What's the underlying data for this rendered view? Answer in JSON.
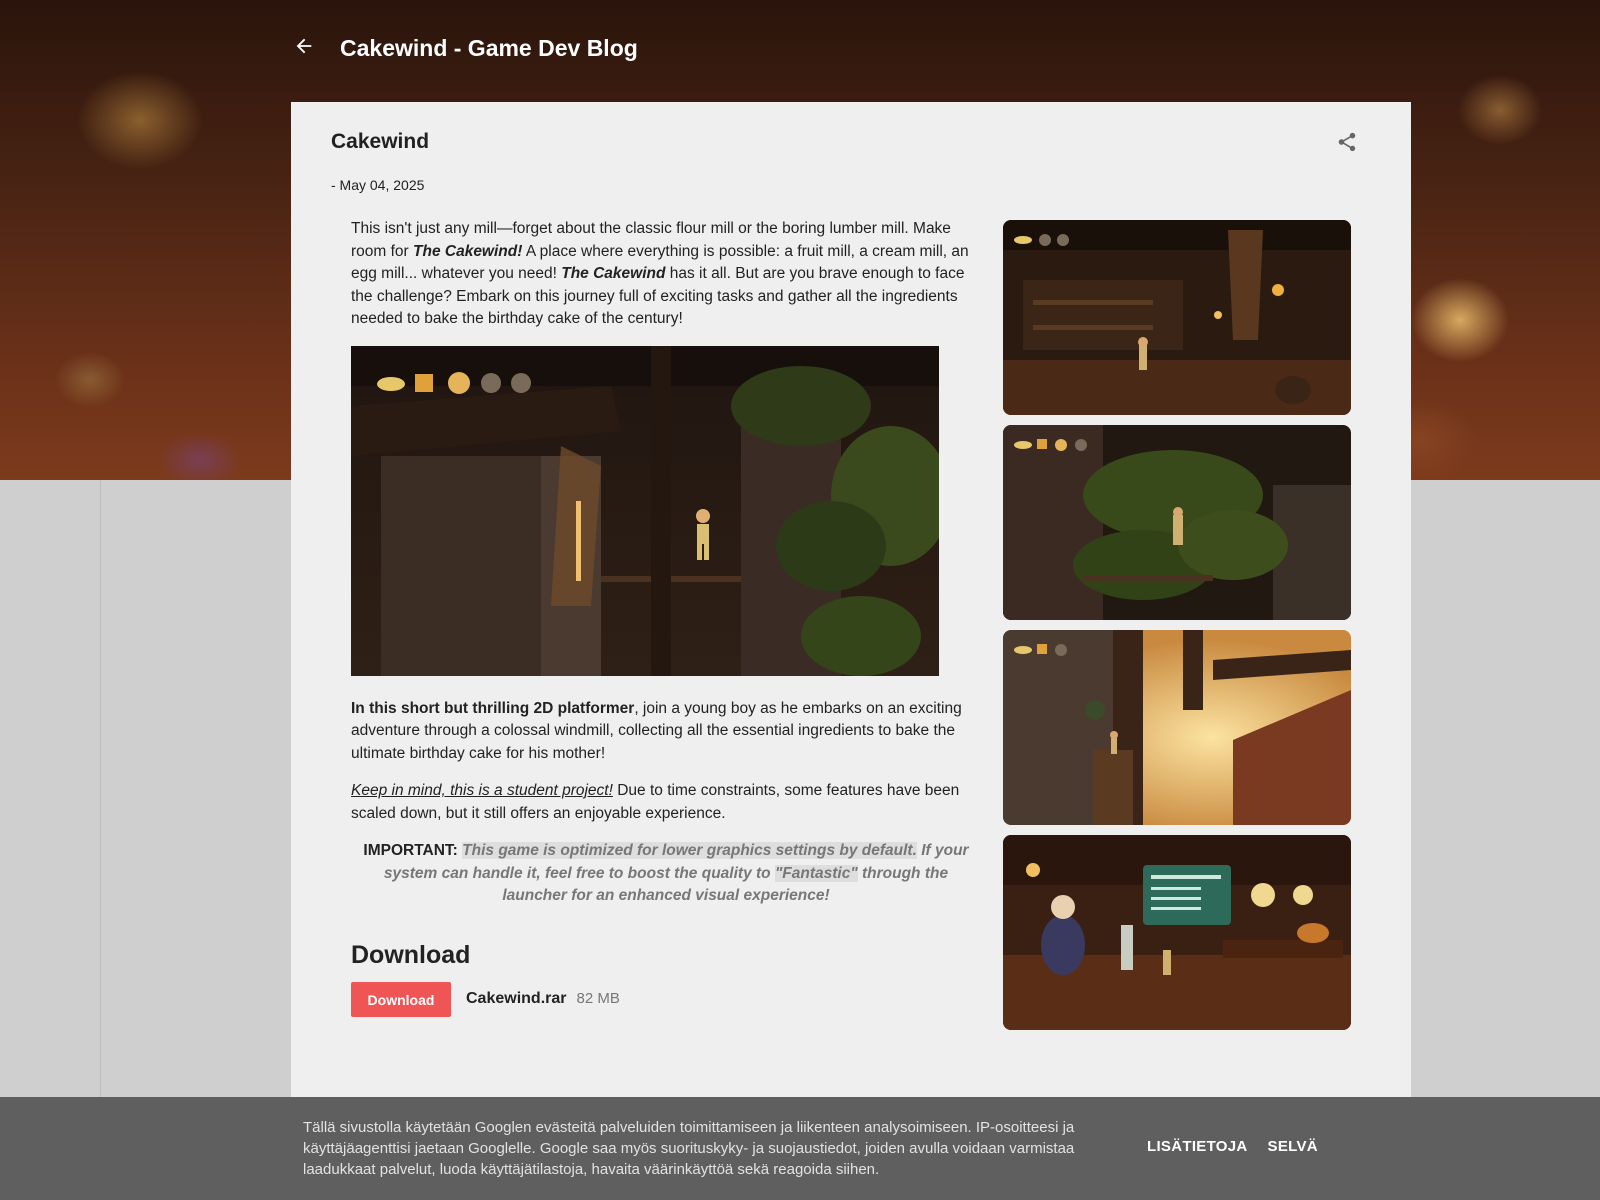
{
  "header": {
    "blog_title": "Cakewind - Game Dev Blog",
    "back_icon": "arrow-left-icon"
  },
  "post": {
    "title": "Cakewind",
    "date": "- May 04, 2025",
    "share_icon": "share-icon",
    "intro": {
      "t1": "This isn't just any mill—forget about the classic flour mill or the boring lumber mill. Make room for ",
      "b1": "The Cakewind!",
      "t2": " A place where everything is possible: a fruit mill, a cream mill, an egg mill... whatever you need! ",
      "b2": "The Cakewind",
      "t3": " has it all. But are you brave enough to face the challenge? Embark on this journey full of exciting tasks and gather all the ingredients needed to bake the birthday cake of the century!"
    },
    "platformer": {
      "bold": "In this short but thrilling 2D platformer",
      "rest": ", join a young boy as he embarks on an exciting adventure through a colossal windmill, collecting all the essential ingredients to bake the ultimate birthday cake for his mother!"
    },
    "student": {
      "link": "Keep in mind, this is a student project!",
      "rest": " Due to time constraints, some features have been scaled down, but it still offers an enjoyable experience."
    },
    "important": {
      "label": "IMPORTANT:",
      "hl1": "This game is optimized for lower graphics settings by default.",
      "mid": " If your system can handle it, feel free to boost the quality to ",
      "hl2": "\"Fantastic\"",
      "end": " through the launcher for an enhanced visual experience!"
    },
    "download": {
      "heading": "Download",
      "button": "Download",
      "file": "Cakewind.rar",
      "size": "82 MB",
      "button_color": "#f05555"
    }
  },
  "cookie": {
    "text": "Tällä sivustolla käytetään Googlen evästeitä palveluiden toimittamiseen ja liikenteen analysoimiseen. IP-osoitteesi ja käyttäjäagenttisi jaetaan Googlelle. Google saa myös suorituskyky- ja suojaustiedot, joiden avulla voidaan varmistaa laadukkaat palvelut, luoda käyttäjätilastoja, havaita väärinkäyttöä sekä reagoida siihen.",
    "learn_more": "LISÄTIETOJA",
    "ok": "SELVÄ"
  },
  "colors": {
    "card_bg": "#efefef",
    "cookie_bg": "#5f5f5f",
    "accent": "#f05555"
  }
}
